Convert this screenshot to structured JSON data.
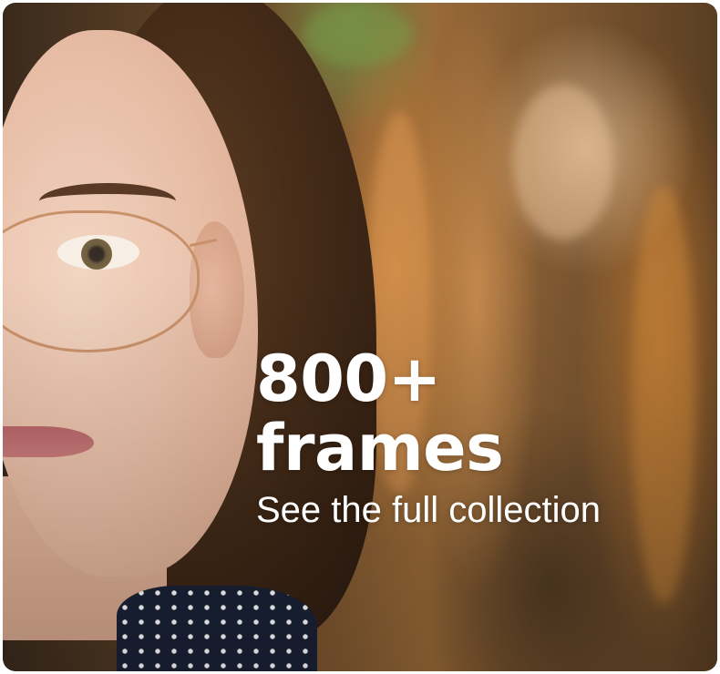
{
  "promo_card": {
    "headline_line1": "800+",
    "headline_line2": "frames",
    "link_text": "See the full collection",
    "image_alt": "Smiling woman with freckles wearing gold wire-frame glasses",
    "text_color": "#ffffff"
  }
}
